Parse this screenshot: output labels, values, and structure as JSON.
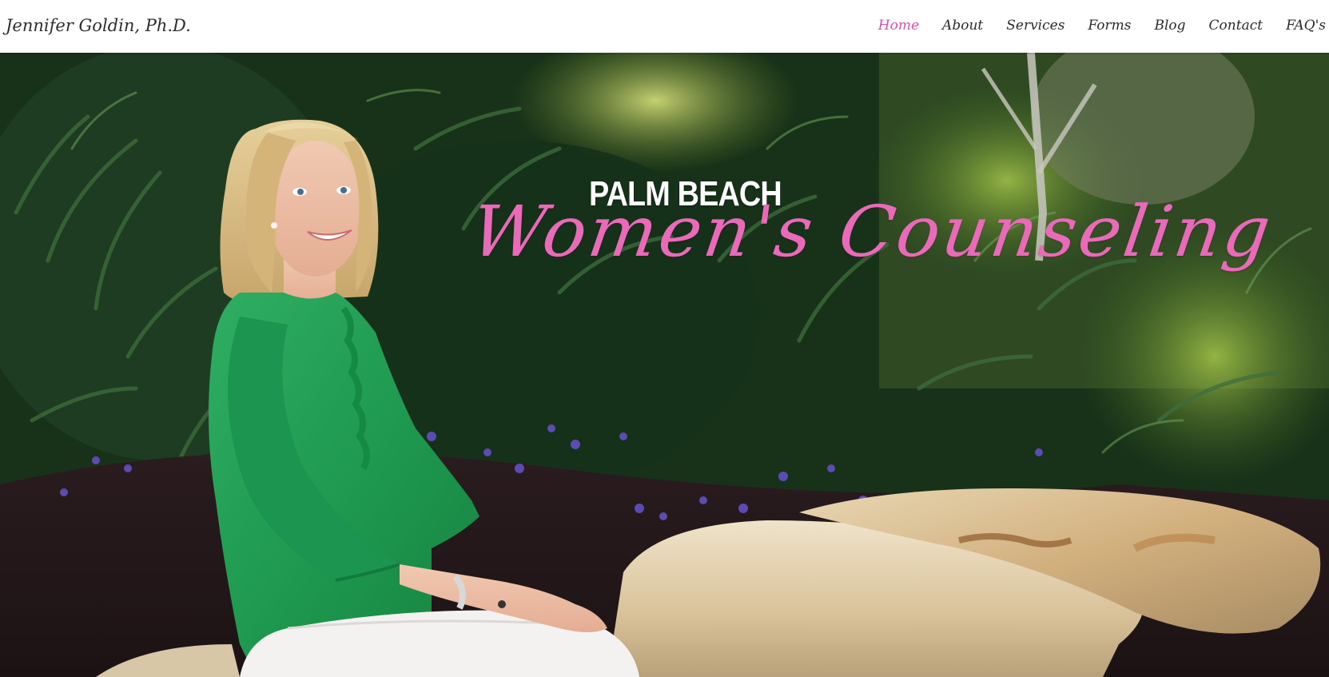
{
  "header": {
    "site_name": "Jennifer Goldin, Ph.D.",
    "nav": [
      {
        "label": "Home",
        "active": true
      },
      {
        "label": "About",
        "active": false
      },
      {
        "label": "Services",
        "active": false
      },
      {
        "label": "Forms",
        "active": false
      },
      {
        "label": "Blog",
        "active": false
      },
      {
        "label": "Contact",
        "active": false
      },
      {
        "label": "FAQ's",
        "active": false
      }
    ],
    "active_color": "#e04bb5"
  },
  "hero": {
    "title_line1": "PALM BEACH",
    "title_line2": "Women's Counseling",
    "script_color": "#e96ab9",
    "image": "woman-in-green-blouse-seated-on-rock-in-garden"
  }
}
